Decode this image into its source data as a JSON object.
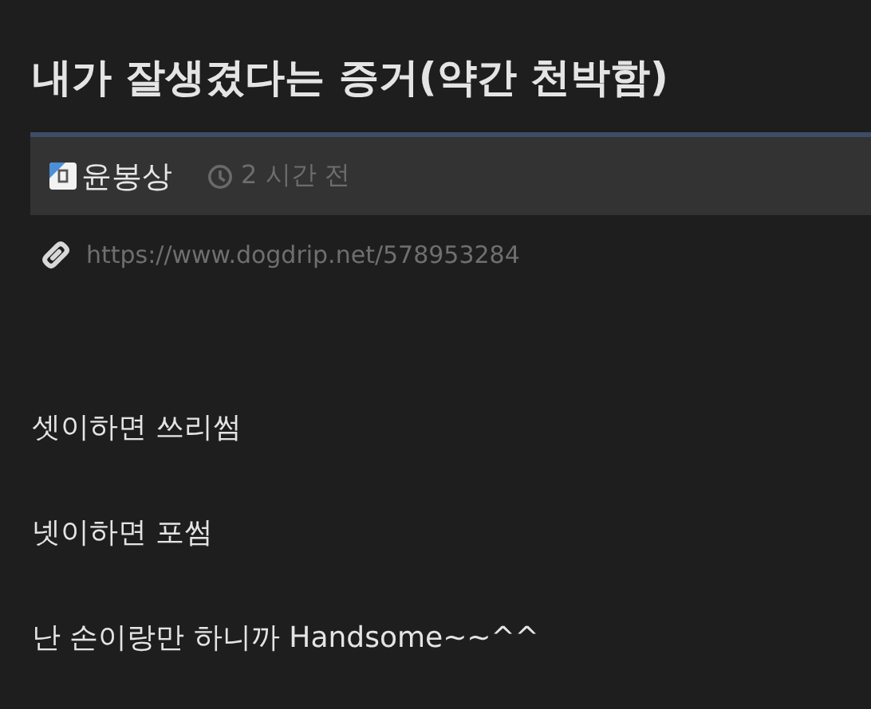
{
  "post": {
    "title": "내가 잘생겼다는 증거(약간 천박함)",
    "author": "윤봉상",
    "time": "2 시간 전",
    "url": "https://www.dogdrip.net/578953284",
    "paragraphs": [
      "셋이하면 쓰리썸",
      "넷이하면 포썸",
      "난 손이랑만 하니까 Handsome~~^^"
    ]
  }
}
